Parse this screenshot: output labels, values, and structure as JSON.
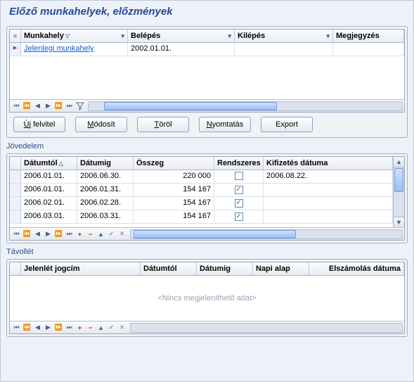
{
  "title": "Előző munkahelyek, előzmények",
  "workplace": {
    "cols": {
      "name": "Munkahely",
      "start": "Belépés",
      "end": "Kilépés",
      "note": "Megjegyzés"
    },
    "rows": [
      {
        "name": "Jelenlegi munkahely",
        "start": "2002.01.01.",
        "end": "",
        "note": ""
      }
    ]
  },
  "buttons": {
    "new_pre": "Ú",
    "new_rest": "j felvitel",
    "modify_pre": "M",
    "modify_rest": "ódosít",
    "delete_pre": "T",
    "delete_rest": "öröl",
    "print_pre": "N",
    "print_rest": "yomtatás",
    "export": "Export"
  },
  "income": {
    "label": "Jövedelem",
    "cols": {
      "from": "Dátumtól",
      "to": "Dátumig",
      "sum": "Összeg",
      "reg": "Rendszeres",
      "paid": "Kifizetés dátuma"
    },
    "rows": [
      {
        "from": "2006.01.01.",
        "to": "2006.06.30.",
        "sum": "220 000",
        "reg": false,
        "paid": "2006.08.22."
      },
      {
        "from": "2006.01.01.",
        "to": "2006.01.31.",
        "sum": "154 167",
        "reg": true,
        "paid": ""
      },
      {
        "from": "2006.02.01.",
        "to": "2006.02.28.",
        "sum": "154 167",
        "reg": true,
        "paid": ""
      },
      {
        "from": "2006.03.01.",
        "to": "2006.03.31.",
        "sum": "154 167",
        "reg": true,
        "paid": ""
      }
    ]
  },
  "absence": {
    "label": "Távollét",
    "cols": {
      "title": "Jelenlét jogcím",
      "from": "Dátumtól",
      "to": "Dátumig",
      "daily": "Napi alap",
      "settle": "Elszámolás dátuma"
    },
    "empty": "<Nincs megjeleníthető adat>"
  }
}
